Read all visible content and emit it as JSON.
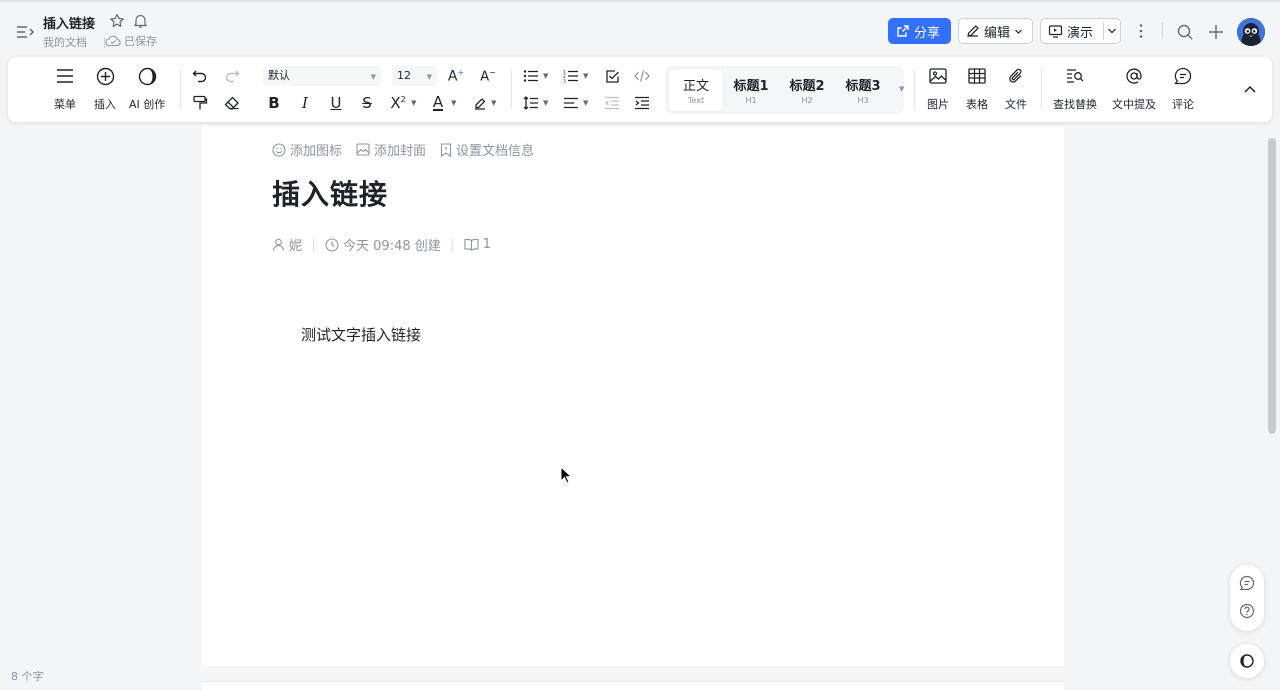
{
  "header": {
    "title": "插入链接",
    "breadcrumb": "我的文档",
    "save_status": "已保存",
    "share_label": "分享",
    "edit_label": "编辑",
    "present_label": "演示",
    "accent_color": "#3370ff"
  },
  "toolbar": {
    "menu_label": "菜单",
    "insert_label": "插入",
    "ai_label": "AI 创作",
    "font_family": "默认",
    "font_size": "12",
    "styles": [
      {
        "label": "正文",
        "sub": "Text"
      },
      {
        "label": "标题1",
        "sub": "H1"
      },
      {
        "label": "标题2",
        "sub": "H2"
      },
      {
        "label": "标题3",
        "sub": "H3"
      }
    ],
    "image_label": "图片",
    "table_label": "表格",
    "file_label": "文件",
    "find_replace_label": "查找替换",
    "mention_label": "文中提及",
    "comment_label": "评论"
  },
  "document": {
    "actions": {
      "add_icon": "添加图标",
      "add_cover": "添加封面",
      "doc_info": "设置文档信息"
    },
    "title": "插入链接",
    "meta": {
      "author": "妮",
      "created": "今天 09:48 创建",
      "reads": "1"
    },
    "body": "测试文字插入链接"
  },
  "footer": {
    "word_count": "8 个字"
  }
}
